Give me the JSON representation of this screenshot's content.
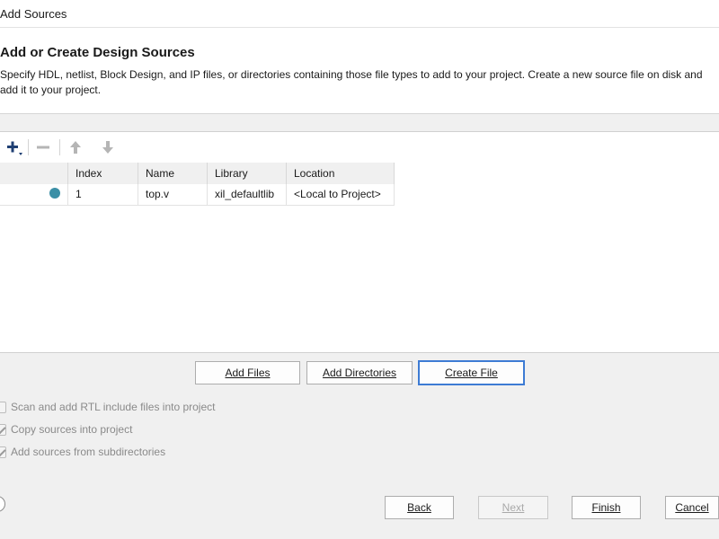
{
  "window": {
    "title": "Add Sources"
  },
  "header": {
    "heading": "Add or Create Design Sources",
    "description": "Specify HDL, netlist, Block Design, and IP files, or directories containing those file types to add to your project. Create a new source file on disk and add it to your project."
  },
  "toolbar": {
    "add_icon": "plus-icon",
    "remove_icon": "minus-icon",
    "up_icon": "arrow-up-icon",
    "down_icon": "arrow-down-icon"
  },
  "table": {
    "columns": [
      "Index",
      "Name",
      "Library",
      "Location"
    ],
    "rows": [
      {
        "status_color": "#3b8fa6",
        "index": "1",
        "name": "top.v",
        "library": "xil_defaultlib",
        "location": "<Local to Project>"
      }
    ]
  },
  "actions": {
    "add_files": "Add Files",
    "add_directories": "Add Directories",
    "create_file": "Create File"
  },
  "options": [
    {
      "label": "Scan and add RTL include files into project",
      "checked": false
    },
    {
      "label": "Copy sources into project",
      "checked": true
    },
    {
      "label": "Add sources from subdirectories",
      "checked": true
    }
  ],
  "footer": {
    "back": "Back",
    "next": "Next",
    "finish": "Finish",
    "cancel": "Cancel"
  }
}
